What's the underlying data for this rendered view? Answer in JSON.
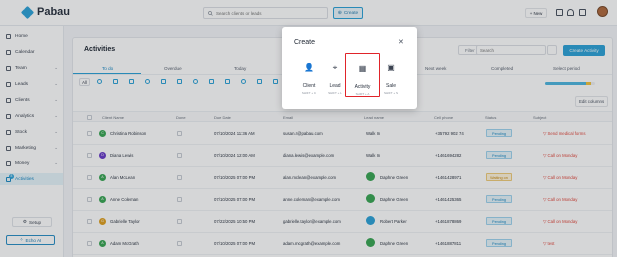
{
  "app": {
    "name": "Pabau"
  },
  "topbar": {
    "search_placeholder": "Search clients or leads",
    "create_label": "Create",
    "new_label": "New"
  },
  "sidebar": {
    "items": [
      {
        "label": "Home",
        "icon": "home-icon",
        "chevron": false
      },
      {
        "label": "Calendar",
        "icon": "calendar-icon",
        "chevron": false
      },
      {
        "label": "Team",
        "icon": "team-icon",
        "chevron": true
      },
      {
        "label": "Leads",
        "icon": "leads-icon",
        "chevron": true
      },
      {
        "label": "Clients",
        "icon": "clients-icon",
        "chevron": true
      },
      {
        "label": "Analytics",
        "icon": "analytics-icon",
        "chevron": true
      },
      {
        "label": "Stock",
        "icon": "stock-icon",
        "chevron": true
      },
      {
        "label": "Marketing",
        "icon": "marketing-icon",
        "chevron": true
      },
      {
        "label": "Money",
        "icon": "money-icon",
        "chevron": true
      },
      {
        "label": "Activities",
        "icon": "activities-icon",
        "chevron": false,
        "active": true,
        "badge": "8"
      }
    ],
    "setup_label": "Setup",
    "echo_label": "Echo AI"
  },
  "page": {
    "title": "Activities",
    "filter_label": "Filter By",
    "search_placeholder": "Search",
    "create_activity_label": "Create Activity",
    "edit_columns_label": "Edit columns",
    "all_label": "All"
  },
  "period_tabs": [
    "To do",
    "Overdue",
    "Today",
    "Tomorrow",
    "This week",
    "Next week",
    "Completed",
    "Select period"
  ],
  "progress": {
    "done_fraction": 0.82,
    "waiting_fraction": 0.1
  },
  "columns": [
    "Client Name",
    "Done",
    "Due Date",
    "Email",
    "Lead name",
    "Cell phone",
    "Status",
    "Subject"
  ],
  "rows": [
    {
      "client": "Christina Robinson",
      "avatar_color": "#3aa655",
      "initials": "CR",
      "due": "07/10/2024 11:36 AM",
      "email": "susan.r@pabau.com",
      "lead": "Walk In",
      "lead_avatar": "",
      "phone": "+35792 902 74",
      "status": "Pending",
      "subject": "Send medical forms"
    },
    {
      "client": "Diana Lewis",
      "avatar_color": "#6a3cc9",
      "initials": "DL",
      "due": "07/10/2024 12:00 AM",
      "email": "diana.lewis@example.com",
      "lead": "Walk In",
      "lead_avatar": "",
      "phone": "+1461694282",
      "status": "Pending",
      "subject": "Call on Monday"
    },
    {
      "client": "Alan McLean",
      "avatar_color": "#3aa655",
      "initials": "AM",
      "due": "07/10/2025 07:00 PM",
      "email": "alan.mclean@example.com",
      "lead": "Daphne Green",
      "lead_avatar": "#3aa655",
      "phone": "+1461428971",
      "status": "Waiting on",
      "subject": "Call on Monday"
    },
    {
      "client": "Anne Coleman",
      "avatar_color": "#3aa655",
      "initials": "AC",
      "due": "07/10/2025 07:00 PM",
      "email": "anne.coleman@example.com",
      "lead": "Daphne Green",
      "lead_avatar": "#3aa655",
      "phone": "+1461425365",
      "status": "Pending",
      "subject": "Call on Monday"
    },
    {
      "client": "Gabrielle Taylor",
      "avatar_color": "#e0a020",
      "initials": "GT",
      "due": "07/22/2025 10:50 PM",
      "email": "gabrielle.taylor@example.com",
      "lead": "Robert Parker",
      "lead_avatar": "#2ea3d8",
      "phone": "+1461878869",
      "status": "Pending",
      "subject": "Call on Monday"
    },
    {
      "client": "Adam McGrath",
      "avatar_color": "#3aa655",
      "initials": "AM",
      "due": "07/10/2025 07:00 PM",
      "email": "adam.mcgrath@example.com",
      "lead": "Daphne Green",
      "lead_avatar": "#3aa655",
      "phone": "+1461887811",
      "status": "Pending",
      "subject": "test"
    }
  ],
  "modal": {
    "title": "Create",
    "options": [
      {
        "label": "Client",
        "shortcut": "SHIFT + C",
        "icon": "person-icon"
      },
      {
        "label": "Lead",
        "shortcut": "SHIFT + L",
        "icon": "target-icon"
      },
      {
        "label": "Activity",
        "shortcut": "SHIFT + A",
        "icon": "calendar-icon",
        "selected": true
      },
      {
        "label": "Sale",
        "shortcut": "SHIFT + S",
        "icon": "sale-icon"
      }
    ]
  },
  "colors": {
    "accent": "#2ea3d8",
    "danger": "#e0473c",
    "highlight": "#e0242a"
  }
}
